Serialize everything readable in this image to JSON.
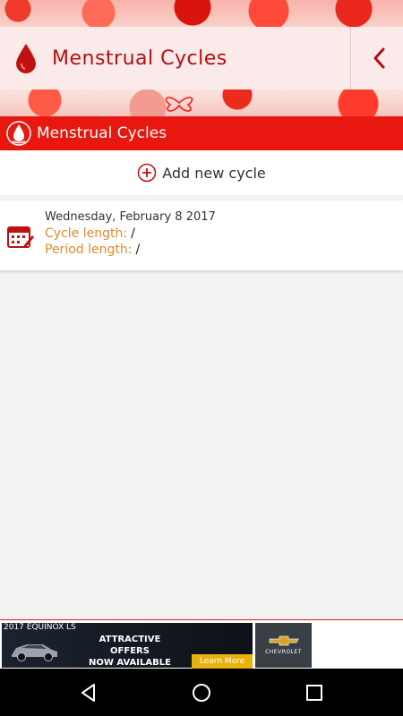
{
  "app": {
    "title_word1": "Menstrual",
    "title_word2": "Cycles"
  },
  "section_header": {
    "word1": "Menstrual",
    "word2": "Cycles"
  },
  "add_cycle": {
    "label": "Add new cycle",
    "icon": "plus-circle-icon"
  },
  "cycles": [
    {
      "date": "Wednesday, February 8 2017",
      "cycle_length_label": "Cycle length:",
      "cycle_length_value": "/",
      "period_length_label": "Period length:",
      "period_length_value": "/"
    }
  ],
  "ad": {
    "model": "2017 EQUINOX LS",
    "offer_line1": "ATTRACTIVE OFFERS",
    "offer_line2": "NOW AVAILABLE",
    "cta": "Learn More",
    "brand": "CHEVROLET"
  },
  "colors": {
    "accent_red": "#e8170f",
    "title_red": "#b31010",
    "label_orange": "#e08a28",
    "ad_cta": "#e8b20c"
  },
  "icons": [
    "blood-drop-icon",
    "back-chevron-icon",
    "blood-drop-white-icon",
    "plus-circle-icon",
    "calendar-edit-icon",
    "nav-back-icon",
    "nav-home-icon",
    "nav-recents-icon"
  ]
}
